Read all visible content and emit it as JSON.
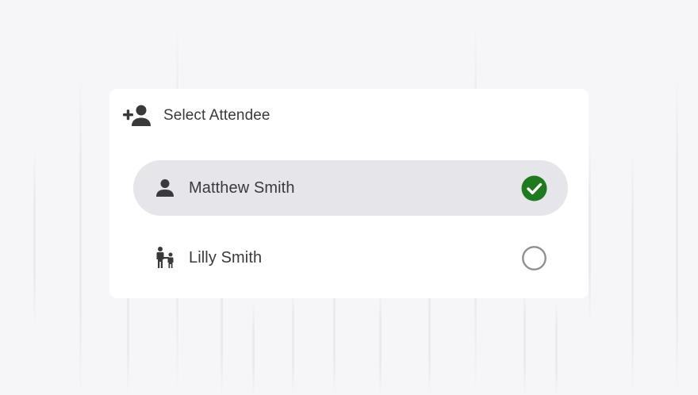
{
  "dialog": {
    "title": "Select Attendee",
    "header_icon": "add-person-icon"
  },
  "attendees": [
    {
      "name": "Matthew Smith",
      "icon": "person-icon",
      "selected": true
    },
    {
      "name": "Lilly Smith",
      "icon": "parent-child-icon",
      "selected": false
    }
  ],
  "colors": {
    "check_green": "#1f7a1f",
    "selected_bg": "#e6e5ea",
    "text": "#3a3a3c",
    "radio_border": "#8e8e93"
  }
}
